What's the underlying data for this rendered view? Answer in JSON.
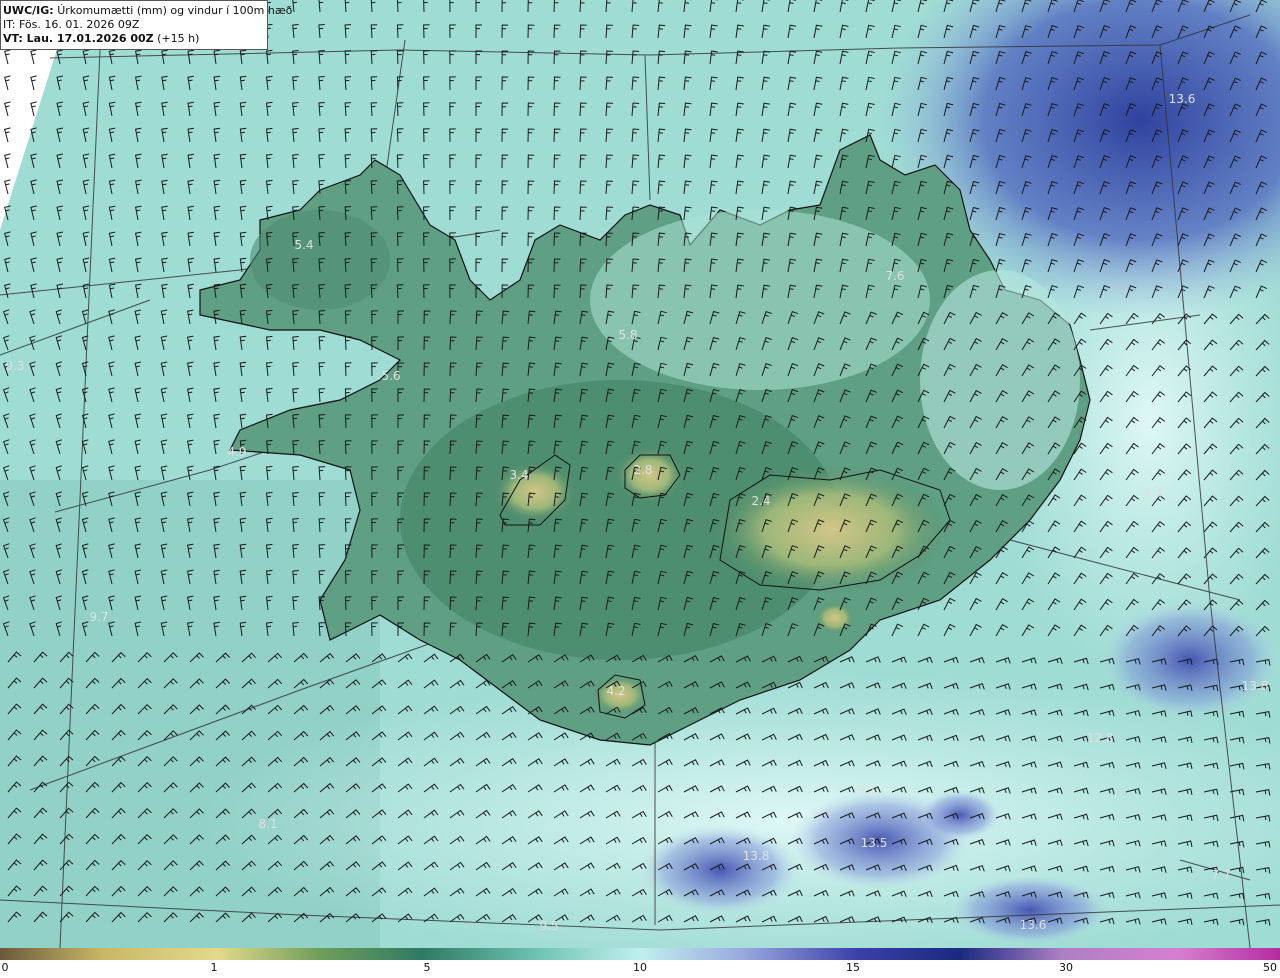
{
  "header": {
    "product": "UWC/IG:",
    "title": "Úrkomumætti (mm) og vindur í 100m hæð",
    "it_line": "IT: Fös. 16. 01. 2026 09Z",
    "vt_label": "VT: Lau. 17.01.2026 00Z",
    "vt_lead": "(+15 h)"
  },
  "map_labels": [
    {
      "text": "13.6"
    },
    {
      "text": "5.4"
    },
    {
      "text": "7.6"
    },
    {
      "text": "5.8"
    },
    {
      "text": "9.3"
    },
    {
      "text": "5.6"
    },
    {
      "text": "4.9"
    },
    {
      "text": "3.4"
    },
    {
      "text": "2.8"
    },
    {
      "text": "2.4"
    },
    {
      "text": "8.4"
    },
    {
      "text": "9.7"
    },
    {
      "text": "4.2"
    },
    {
      "text": "13.8"
    },
    {
      "text": "12.8"
    },
    {
      "text": "9.1"
    },
    {
      "text": "8.1"
    },
    {
      "text": "13.8"
    },
    {
      "text": "13.5"
    },
    {
      "text": "7.7"
    },
    {
      "text": "9.5"
    },
    {
      "text": "13.6"
    }
  ],
  "colorbar": {
    "ticks": [
      "0",
      "1",
      "5",
      "10",
      "15",
      "30",
      "50"
    ],
    "colors": [
      "#6b5a3c",
      "#c8b766",
      "#e3d98a",
      "#6f9e5a",
      "#2f7a63",
      "#6fc3b3",
      "#bff0ee",
      "#9aa9e0",
      "#3c3fa8",
      "#1a2a80",
      "#ad7fc4",
      "#d77fd0",
      "#b52ba2"
    ]
  }
}
